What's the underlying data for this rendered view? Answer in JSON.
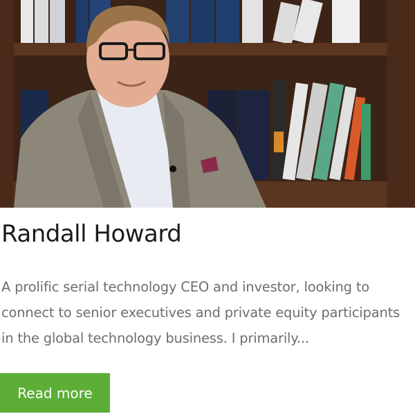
{
  "profile": {
    "name": "Randall Howard",
    "bio": "A prolific serial technology CEO and investor, looking to connect to senior executives and private equity participants in the global technology business. I primarily...",
    "read_more_label": "Read more"
  },
  "colors": {
    "button_bg": "#5cae37",
    "button_text": "#ffffff",
    "name_text": "#1a1a1a",
    "bio_text": "#6e6e6e"
  }
}
